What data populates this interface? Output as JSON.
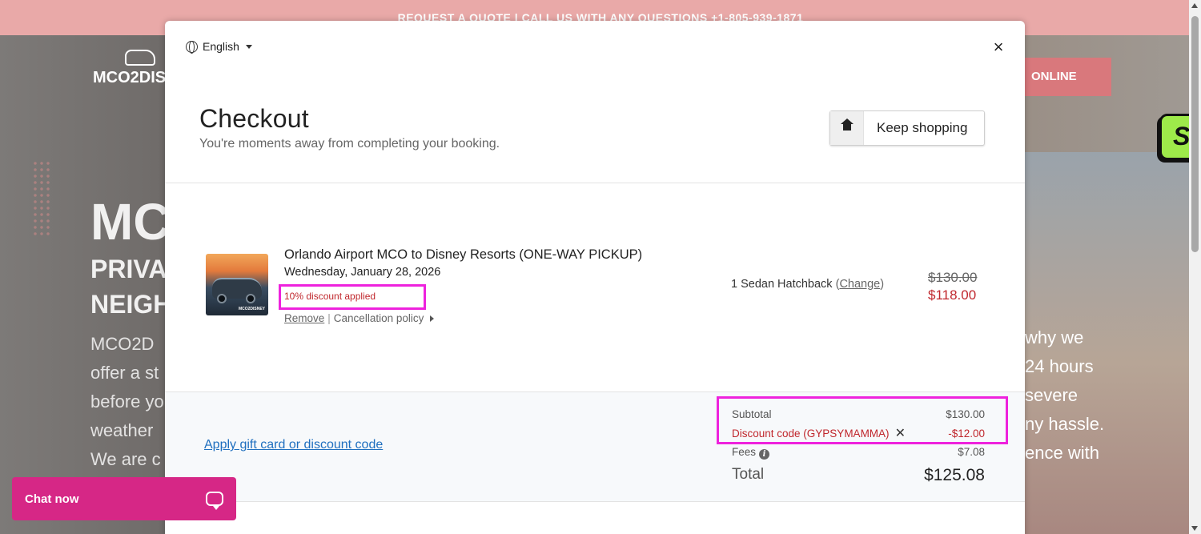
{
  "background": {
    "banner": "REQUEST A QUOTE | CALL US WITH ANY QUESTIONS +1-805-939-1871",
    "logo_text": "MCO2DIS",
    "hero_big": "MC",
    "hero_lines": [
      "PRIVAT",
      "NEIGH"
    ],
    "hero_text": [
      "MCO2D",
      "offer a st",
      "before yo",
      "weather",
      "We are c"
    ],
    "right_button": "ONLINE",
    "right_text": [
      "why we",
      "24 hours",
      "severe",
      "ny hassle.",
      "ence with"
    ],
    "side_badge": "S"
  },
  "modal": {
    "language": "English",
    "close_label": "×",
    "title": "Checkout",
    "subtitle": "You're moments away from completing your booking.",
    "keep_shopping": "Keep shopping"
  },
  "item": {
    "image_watermark": "MCO2DISNEY",
    "title": "Orlando Airport MCO to Disney Resorts (ONE-WAY PICKUP)",
    "date": "Wednesday, January 28, 2026",
    "discount_note": "10% discount applied",
    "remove": "Remove",
    "separator": "|",
    "cancellation": "Cancellation policy",
    "vehicle": "1 Sedan Hatchback",
    "change": "Change",
    "price_original": "$130.00",
    "price_discounted": "$118.00"
  },
  "summary": {
    "gift_link": "Apply gift card or discount code",
    "subtotal_label": "Subtotal",
    "subtotal_value": "$130.00",
    "discount_label": "Discount code (GYPSYMAMMA)",
    "discount_value": "-$12.00",
    "fees_label": "Fees",
    "fees_value": "$7.08",
    "total_label": "Total",
    "total_value": "$125.08"
  },
  "chat": {
    "label": "Chat now"
  },
  "colors": {
    "accent_red": "#c0272d",
    "link_blue": "#1f6fbf",
    "highlight_magenta": "#ee22dd",
    "chat_pink": "#d62786",
    "badge_green": "#9eea4a"
  }
}
